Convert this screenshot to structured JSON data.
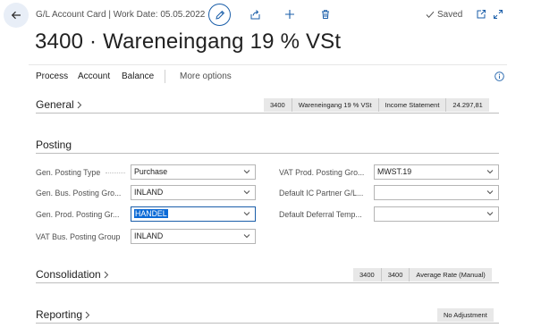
{
  "topbar": {
    "title": "G/L Account Card | Work Date: 05.05.2022",
    "saved_label": "Saved"
  },
  "page_title": "3400 · Wareneingang 19 % VSt",
  "actions": {
    "process": "Process",
    "account": "Account",
    "balance": "Balance",
    "more": "More options"
  },
  "general": {
    "title": "General",
    "chips": [
      "3400",
      "Wareneingang 19 % VSt",
      "Income Statement",
      "24.297,81"
    ]
  },
  "posting": {
    "title": "Posting",
    "left": [
      {
        "label": "Gen. Posting Type",
        "value": "Purchase"
      },
      {
        "label": "Gen. Bus. Posting Gro...",
        "value": "INLAND"
      },
      {
        "label": "Gen. Prod. Posting Gr...",
        "value": "HANDEL"
      },
      {
        "label": "VAT Bus. Posting Group",
        "value": "INLAND"
      }
    ],
    "right": [
      {
        "label": "VAT Prod. Posting Gro...",
        "value": "MWST.19"
      },
      {
        "label": "Default IC Partner G/L...",
        "value": ""
      },
      {
        "label": "Default Deferral Temp...",
        "value": ""
      }
    ]
  },
  "consolidation": {
    "title": "Consolidation",
    "chips": [
      "3400",
      "3400",
      "Average Rate (Manual)"
    ]
  },
  "reporting": {
    "title": "Reporting",
    "chips": [
      "No Adjustment"
    ]
  },
  "colors": {
    "accent": "#1a5ea9",
    "selection": "#0b6ad6",
    "chip_bg": "#e8e8e8"
  },
  "icons": [
    "back-arrow-icon",
    "pencil-icon",
    "share-icon",
    "plus-icon",
    "delete-icon",
    "checkmark-icon",
    "open-in-new-window-icon",
    "expand-icon",
    "info-icon",
    "chevron-right-icon",
    "chevron-down-icon"
  ]
}
